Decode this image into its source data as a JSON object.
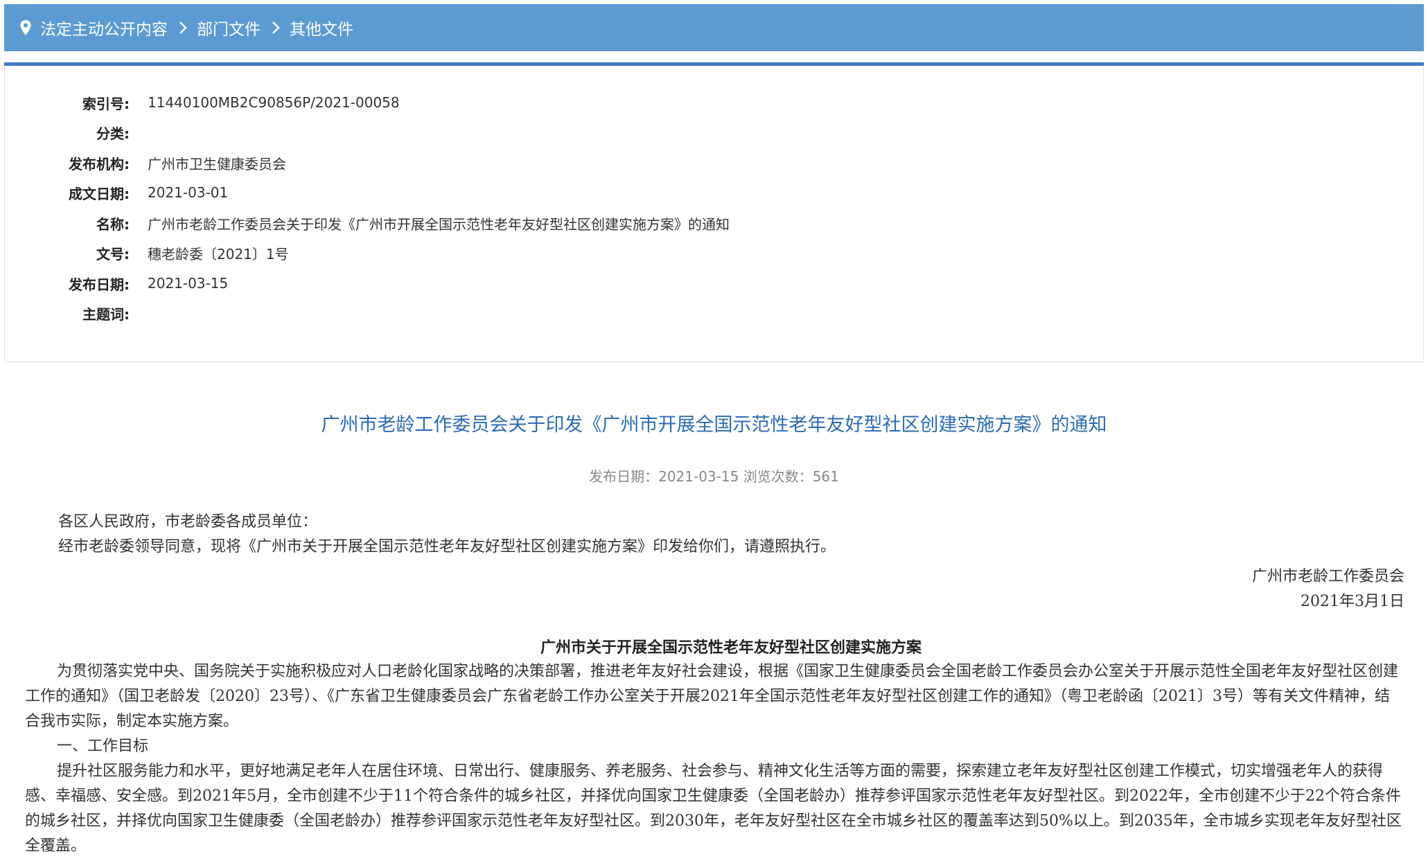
{
  "breadcrumb": {
    "items": [
      "法定主动公开内容",
      "部门文件",
      "其他文件"
    ],
    "bg_color": "#5b9bd1"
  },
  "meta": [
    {
      "label": "索引号:",
      "value": "11440100MB2C90856P/2021-00058"
    },
    {
      "label": "分类:",
      "value": ""
    },
    {
      "label": "发布机构:",
      "value": "广州市卫生健康委员会"
    },
    {
      "label": "成文日期:",
      "value": "2021-03-01"
    },
    {
      "label": "名称:",
      "value": "广州市老龄工作委员会关于印发《广州市开展全国示范性老年友好型社区创建实施方案》的通知"
    },
    {
      "label": "文号:",
      "value": "穗老龄委〔2021〕1号"
    },
    {
      "label": "发布日期:",
      "value": "2021-03-15"
    },
    {
      "label": "主题词:",
      "value": ""
    }
  ],
  "document": {
    "title": "广州市老龄工作委员会关于印发《广州市开展全国示范性老年友好型社区创建实施方案》的通知",
    "info": "发布日期：2021-03-15  浏览次数：561",
    "title_color": "#2a6bb5",
    "salutation": "各区人民政府，市老龄委各成员单位：",
    "intro": "经市老龄委领导同意，现将《广州市关于开展全国示范性老年友好型社区创建实施方案》印发给你们，请遵照执行。",
    "signer": "广州市老龄工作委员会",
    "sign_date": "2021年3月1日",
    "plan_title": "广州市关于开展全国示范性老年友好型社区创建实施方案",
    "para1": "为贯彻落实党中央、国务院关于实施积极应对人口老龄化国家战略的决策部署，推进老年友好社会建设，根据《国家卫生健康委员会全国老龄工作委员会办公室关于开展示范性全国老年友好型社区创建工作的通知》（国卫老龄发〔2020〕23号）、《广东省卫生健康委员会广东省老龄工作办公室关于开展2021年全国示范性老年友好型社区创建工作的通知》（粤卫老龄函〔2021〕3号）等有关文件精神，结合我市实际，制定本实施方案。",
    "section1": "一、工作目标",
    "para2": "提升社区服务能力和水平，更好地满足老年人在居住环境、日常出行、健康服务、养老服务、社会参与、精神文化生活等方面的需要，探索建立老年友好型社区创建工作模式，切实增强老年人的获得感、幸福感、安全感。到2021年5月，全市创建不少于11个符合条件的城乡社区，并择优向国家卫生健康委（全国老龄办）推荐参评国家示范性老年友好型社区。到2022年，全市创建不少于22个符合条件的城乡社区，并择优向国家卫生健康委（全国老龄办）推荐参评国家示范性老年友好型社区。到2030年，老年友好型社区在全市城乡社区的覆盖率达到50%以上。到2035年，全市城乡实现老年友好型社区全覆盖。"
  }
}
